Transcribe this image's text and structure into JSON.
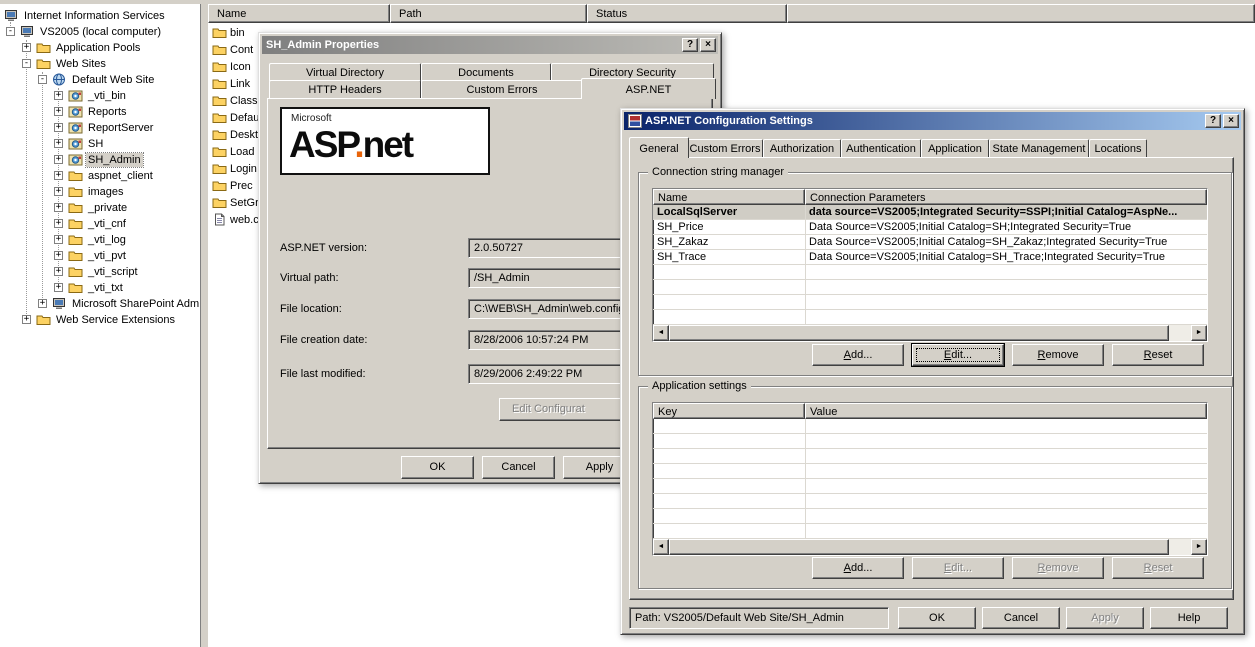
{
  "colors": {
    "face": "#d4d0c8",
    "active_title_start": "#0a246a",
    "active_title_end": "#a6caf0",
    "inactive_title_start": "#7f7f7f",
    "inactive_title_end": "#bdbcb7"
  },
  "icons": {
    "help": "?",
    "close": "×",
    "expand_plus": "+",
    "expand_minus": "-",
    "scroll_left": "◄",
    "scroll_right": "►"
  },
  "window": {
    "tree": {
      "items": [
        {
          "label": "Internet Information Services",
          "level": -1,
          "expand": "none",
          "icon": "computer"
        },
        {
          "label": "VS2005 (local computer)",
          "level": 0,
          "expand": "minus",
          "icon": "computer"
        },
        {
          "label": "Application Pools",
          "level": 1,
          "expand": "plus",
          "icon": "folder"
        },
        {
          "label": "Web Sites",
          "level": 1,
          "expand": "minus",
          "icon": "folder"
        },
        {
          "label": "Default Web Site",
          "level": 2,
          "expand": "minus",
          "icon": "globe"
        },
        {
          "label": "_vti_bin",
          "level": 3,
          "expand": "plus",
          "icon": "app"
        },
        {
          "label": "Reports",
          "level": 3,
          "expand": "plus",
          "icon": "app"
        },
        {
          "label": "ReportServer",
          "level": 3,
          "expand": "plus",
          "icon": "app"
        },
        {
          "label": "SH",
          "level": 3,
          "expand": "plus",
          "icon": "app"
        },
        {
          "label": "SH_Admin",
          "level": 3,
          "expand": "plus",
          "icon": "app",
          "selected": true
        },
        {
          "label": "aspnet_client",
          "level": 3,
          "expand": "plus",
          "icon": "folder"
        },
        {
          "label": "images",
          "level": 3,
          "expand": "plus",
          "icon": "folder"
        },
        {
          "label": "_private",
          "level": 3,
          "expand": "plus",
          "icon": "folder"
        },
        {
          "label": "_vti_cnf",
          "level": 3,
          "expand": "plus",
          "icon": "folder"
        },
        {
          "label": "_vti_log",
          "level": 3,
          "expand": "plus",
          "icon": "folder"
        },
        {
          "label": "_vti_pvt",
          "level": 3,
          "expand": "plus",
          "icon": "folder"
        },
        {
          "label": "_vti_script",
          "level": 3,
          "expand": "plus",
          "icon": "folder"
        },
        {
          "label": "_vti_txt",
          "level": 3,
          "expand": "plus",
          "icon": "folder"
        },
        {
          "label": "Microsoft SharePoint Adm",
          "level": 2,
          "expand": "plus",
          "icon": "computer"
        },
        {
          "label": "Web Service Extensions",
          "level": 1,
          "expand": "plus",
          "icon": "folder"
        }
      ]
    },
    "list": {
      "columns": [
        "Name",
        "Path",
        "Status"
      ],
      "items": [
        {
          "label": "bin",
          "icon": "folder"
        },
        {
          "label": "Cont",
          "icon": "folder"
        },
        {
          "label": "Icon",
          "icon": "folder"
        },
        {
          "label": "Link",
          "icon": "folder"
        },
        {
          "label": "Class",
          "icon": "folder"
        },
        {
          "label": "Defau",
          "icon": "folder"
        },
        {
          "label": "Deskt",
          "icon": "folder"
        },
        {
          "label": "Load",
          "icon": "folder"
        },
        {
          "label": "Login",
          "icon": "folder"
        },
        {
          "label": "Prec",
          "icon": "folder"
        },
        {
          "label": "SetGr",
          "icon": "folder"
        },
        {
          "label": "web.c",
          "icon": "doc"
        }
      ]
    }
  },
  "props_dialog": {
    "title": "SH_Admin Properties",
    "tabs_row1": [
      "Virtual Directory",
      "Documents",
      "Directory Security"
    ],
    "tabs_row2": [
      "HTTP Headers",
      "Custom Errors",
      "ASP.NET"
    ],
    "active_tab": "ASP.NET",
    "logo": {
      "brand": "Microsoft",
      "name_a": "ASP",
      "dot": ".",
      "name_b": "net"
    },
    "fields": [
      {
        "label": "ASP.NET version:",
        "value": "2.0.50727"
      },
      {
        "label": "Virtual path:",
        "value": "/SH_Admin"
      },
      {
        "label": "File location:",
        "value": "C:\\WEB\\SH_Admin\\web.config"
      },
      {
        "label": "File creation date:",
        "value": "8/28/2006 10:57:24 PM"
      },
      {
        "label": "File last modified:",
        "value": "8/29/2006 2:49:22 PM"
      }
    ],
    "edit_button_label": "Edit Configurat",
    "buttons": [
      {
        "label": "OK"
      },
      {
        "label": "Cancel"
      },
      {
        "label": "Apply"
      }
    ]
  },
  "config_dialog": {
    "title": "ASP.NET Configuration Settings",
    "tabs": [
      "General",
      "Custom Errors",
      "Authorization",
      "Authentication",
      "Application",
      "State Management",
      "Locations"
    ],
    "active_tab": "General",
    "connection_group": {
      "title": "Connection string manager",
      "columns": [
        "Name",
        "Connection Parameters"
      ],
      "rows": [
        {
          "name": "LocalSqlServer",
          "value": "data source=VS2005;Integrated Security=SSPI;Initial Catalog=AspNe...",
          "bold": true,
          "selected": true
        },
        {
          "name": "SH_Price",
          "value": "Data Source=VS2005;Initial Catalog=SH;Integrated Security=True"
        },
        {
          "name": "SH_Zakaz",
          "value": "Data Source=VS2005;Initial Catalog=SH_Zakaz;Integrated Security=True"
        },
        {
          "name": "SH_Trace",
          "value": "Data Source=VS2005;Initial Catalog=SH_Trace;Integrated Security=True"
        }
      ],
      "buttons": [
        {
          "label": "Add..."
        },
        {
          "label": "Edit...",
          "default": true
        },
        {
          "label": "Remove"
        },
        {
          "label": "Reset"
        }
      ]
    },
    "app_settings_group": {
      "title": "Application settings",
      "columns": [
        "Key",
        "Value"
      ],
      "rows": [],
      "buttons": [
        {
          "label": "Add..."
        },
        {
          "label": "Edit...",
          "disabled": true
        },
        {
          "label": "Remove",
          "disabled": true
        },
        {
          "label": "Reset",
          "disabled": true
        }
      ]
    },
    "path_label": "Path: VS2005/Default Web Site/SH_Admin",
    "buttons": [
      {
        "label": "OK"
      },
      {
        "label": "Cancel"
      },
      {
        "label": "Apply",
        "disabled": true
      },
      {
        "label": "Help"
      }
    ]
  }
}
